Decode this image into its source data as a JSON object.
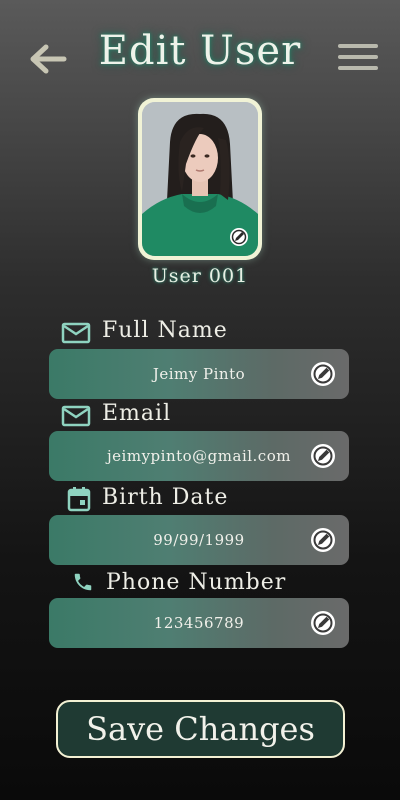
{
  "header": {
    "title": "Edit User",
    "back_icon": "arrow-left-icon",
    "menu_icon": "hamburger-menu-icon"
  },
  "profile": {
    "user_id": "User 001",
    "avatar": "profile-photo"
  },
  "fields": [
    {
      "label": "Full Name",
      "value": "Jeimy Pinto",
      "icon": "mail-icon"
    },
    {
      "label": "Email",
      "value": "jeimypinto@gmail.com",
      "icon": "mail-icon"
    },
    {
      "label": "Birth Date",
      "value": "99/99/1999",
      "icon": "calendar-icon"
    },
    {
      "label": "Phone Number",
      "value": "123456789",
      "icon": "phone-icon"
    }
  ],
  "actions": {
    "save_label": "Save Changes"
  },
  "colors": {
    "accent": "#4a8c79",
    "icon": "#8fd3c0",
    "button_border": "#f3f1d4",
    "button_bg": "#1f3a33"
  }
}
